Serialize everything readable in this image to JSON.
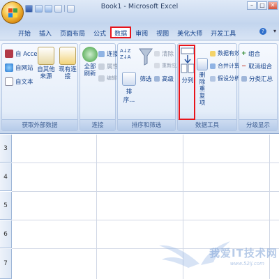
{
  "window": {
    "title": "Book1 - Microsoft Excel",
    "min": "–",
    "max": "□",
    "close": "✕"
  },
  "tabs": [
    {
      "label": "开始",
      "active": false
    },
    {
      "label": "插入",
      "active": false
    },
    {
      "label": "页面布局",
      "active": false
    },
    {
      "label": "公式",
      "active": false
    },
    {
      "label": "数据",
      "active": true
    },
    {
      "label": "审阅",
      "active": false
    },
    {
      "label": "视图",
      "active": false
    },
    {
      "label": "美化大师",
      "active": false
    },
    {
      "label": "开发工具",
      "active": false
    }
  ],
  "help": "?",
  "ribbon": {
    "get_external": {
      "label": "获取外部数据",
      "access": "自 Access",
      "web": "自网站",
      "text": "自文本",
      "other": "自其他来源",
      "existing": "现有连接"
    },
    "connections": {
      "label": "连接",
      "refresh_all": "全部刷新",
      "connections": "连接",
      "properties": "属性",
      "edit_links": "编辑链接"
    },
    "sort_filter": {
      "label": "排序和筛选",
      "sort": "排序...",
      "filter": "筛选",
      "clear": "清除",
      "reapply": "重新应用",
      "advanced": "高级"
    },
    "data_tools": {
      "label": "数据工具",
      "text_to_columns": "分列",
      "remove_duplicates": "删除重复项",
      "validation": "数据有效性",
      "consolidate": "合并计算",
      "whatif": "假设分析"
    },
    "outline": {
      "label": "分级显示",
      "group": "组合",
      "ungroup": "取消组合",
      "subtotal": "分类汇总"
    }
  },
  "sheet": {
    "row_numbers": [
      "3",
      "4",
      "5",
      "6",
      "7"
    ]
  },
  "watermark": {
    "text": "我爱IT技术网",
    "url": "www.52ij.com"
  }
}
